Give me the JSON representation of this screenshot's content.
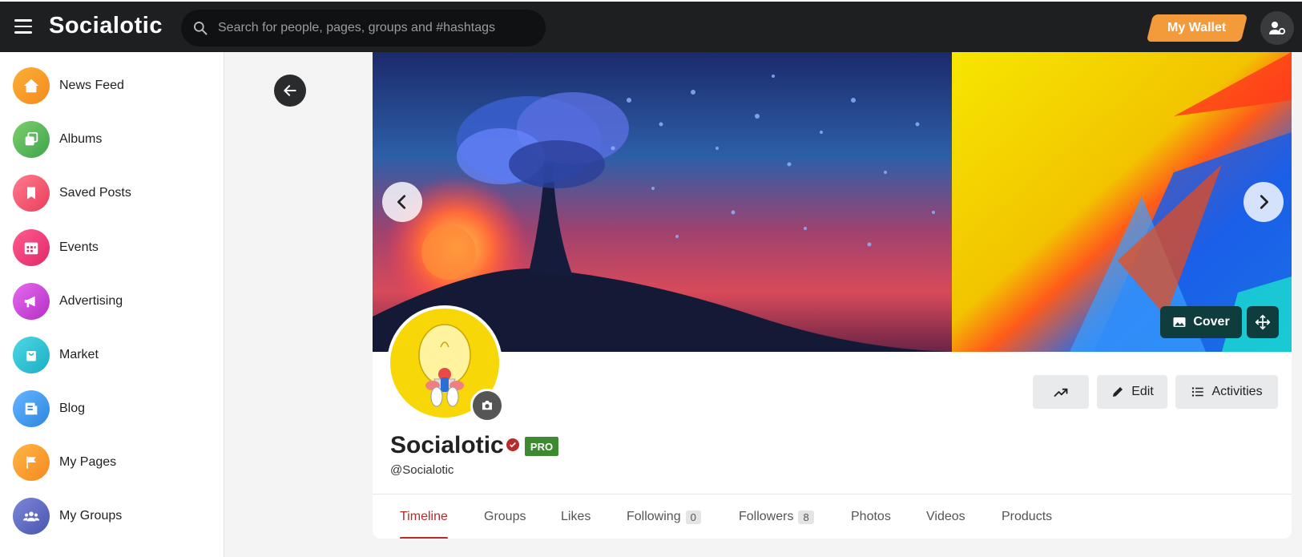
{
  "app": {
    "logo": "Socialotic",
    "search_placeholder": "Search for people, pages, groups and #hashtags",
    "wallet_label": "My Wallet"
  },
  "sidebar": {
    "items": [
      {
        "label": "News Feed",
        "icon": "home-icon",
        "color": "#f5a623"
      },
      {
        "label": "Albums",
        "icon": "albums-icon",
        "color": "#5cb85c"
      },
      {
        "label": "Saved Posts",
        "icon": "bookmark-icon",
        "color": "#f2576e"
      },
      {
        "label": "Events",
        "icon": "calendar-icon",
        "color": "#ee3f7b"
      },
      {
        "label": "Advertising",
        "icon": "megaphone-icon",
        "color": "#d046d8"
      },
      {
        "label": "Market",
        "icon": "shopping-bag-icon",
        "color": "#2ec4d6"
      },
      {
        "label": "Blog",
        "icon": "blog-icon",
        "color": "#3b9cf0"
      },
      {
        "label": "My Pages",
        "icon": "flag-icon",
        "color": "#f5a623"
      },
      {
        "label": "My Groups",
        "icon": "group-icon",
        "color": "#5c6bc0"
      }
    ]
  },
  "profile": {
    "name": "Socialotic",
    "badge": "PRO",
    "handle": "@Socialotic",
    "cover_button": "Cover",
    "edit_button": "Edit",
    "activities_button": "Activities"
  },
  "tabs": [
    {
      "label": "Timeline",
      "active": true
    },
    {
      "label": "Groups"
    },
    {
      "label": "Likes"
    },
    {
      "label": "Following",
      "count": "0"
    },
    {
      "label": "Followers",
      "count": "8"
    },
    {
      "label": "Photos"
    },
    {
      "label": "Videos"
    },
    {
      "label": "Products"
    }
  ],
  "colors": {
    "accent": "#b52b2b",
    "topbar": "#1e1f21",
    "wallet": "#f39a3a",
    "cover_button": "#0f3d3e",
    "pro_badge": "#3d8a31"
  }
}
